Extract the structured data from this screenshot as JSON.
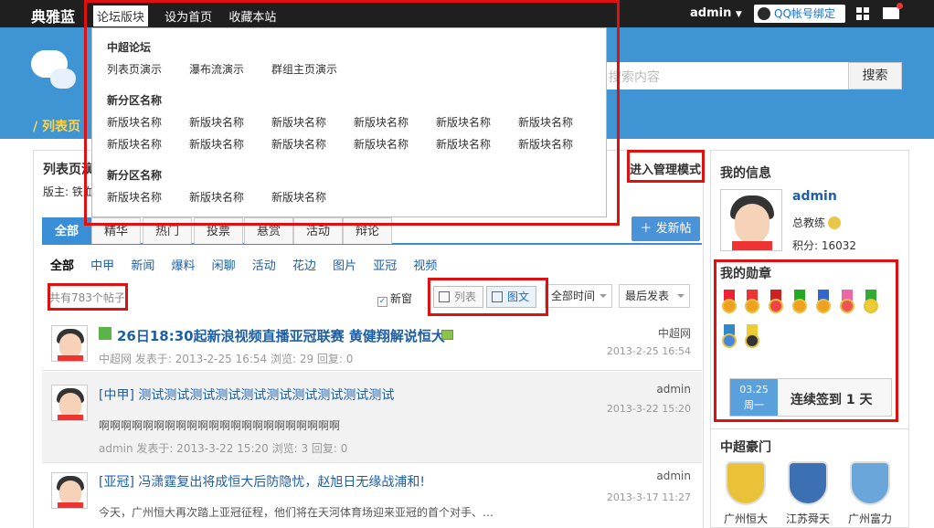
{
  "header": {
    "site_name": "典雅蓝",
    "nav": [
      "论坛版块",
      "设为首页",
      "收藏本站"
    ],
    "user": "admin",
    "qq_bind": "QQ帐号绑定"
  },
  "search": {
    "placeholder": "搜索内容",
    "button": "搜索"
  },
  "breadcrumb": "/ 列表页",
  "forum": {
    "title": "列表页演示",
    "moderator": "版主: 铁血",
    "manage_mode": "进入管理模式",
    "tabs": [
      "全部",
      "精华",
      "热门",
      "投票",
      "悬赏",
      "活动",
      "辩论"
    ],
    "new_post": "＋ 发新帖",
    "subtabs": [
      "全部",
      "中甲",
      "新闻",
      "爆料",
      "闲聊",
      "活动",
      "花边",
      "图片",
      "亚冠",
      "视频"
    ],
    "post_count": "共有783个帖子",
    "new_window": "新窗",
    "view_list": "列表",
    "view_image": "图文",
    "filter_time": "全部时间",
    "filter_sort": "最后发表"
  },
  "posts": [
    {
      "tag": "",
      "title": "26日18:30起新浪视频直播亚冠联赛 黄健翔解说恒大",
      "meta": "中超网   发表于: 2013-2-25 16:54   浏览: 29  回复: 0",
      "body": "",
      "author": "中超网",
      "date": "2013-2-25 16:54"
    },
    {
      "tag": "[中甲]",
      "title": "测试测试测试测试测试测试测试测试测试测试",
      "meta": "admin   发表于: 2013-3-22 15:20   浏览: 3  回复: 0",
      "body": "啊啊啊啊啊啊啊啊啊啊啊啊啊啊啊啊啊啊啊啊啊啊",
      "author": "admin",
      "date": "2013-3-22 15:20"
    },
    {
      "tag": "[亚冠]",
      "title": "冯潇霆复出将成恒大后防隐忧，赵旭日无缘战浦和!",
      "meta": "",
      "body": "今天，广州恒大再次踏上亚冠征程，他们将在天河体育场迎来亚冠的首个对手、…",
      "author": "admin",
      "date": "2013-3-17 11:27"
    }
  ],
  "sidebar": {
    "my_info": "我的信息",
    "username": "admin",
    "rank": "总教练",
    "points": "积分: 16032",
    "medals_title": "我的勋章",
    "sign_date": "03.25",
    "sign_weekday": "周一",
    "sign_text": "连续签到 1 天",
    "clubs_title": "中超豪门",
    "clubs": [
      "广州恒大",
      "江苏舜天",
      "广州富力"
    ]
  },
  "dropdown": {
    "sections": [
      {
        "title": "中超论坛",
        "items": [
          "列表页演示",
          "瀑布流演示",
          "群组主页演示"
        ]
      },
      {
        "title": "新分区名称",
        "items": [
          "新版块名称",
          "新版块名称",
          "新版块名称",
          "新版块名称",
          "新版块名称",
          "新版块名称",
          "新版块名称",
          "新版块名称",
          "新版块名称",
          "新版块名称",
          "新版块名称",
          "新版块名称"
        ]
      },
      {
        "title": "新分区名称",
        "items": [
          "新版块名称",
          "新版块名称",
          "新版块名称"
        ]
      }
    ]
  },
  "colors": {
    "accent": "#3a8ed6",
    "highlight": "#e01010",
    "banner": "#3f95d3"
  }
}
